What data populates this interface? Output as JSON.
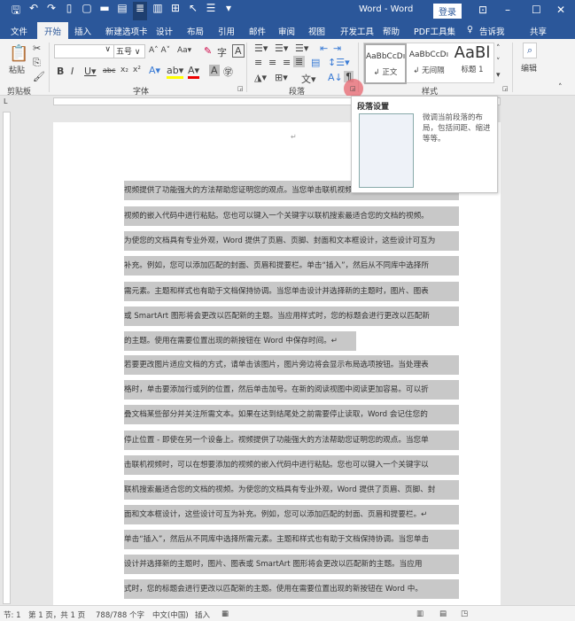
{
  "title": {
    "doc": "Word - Word",
    "login": "登录"
  },
  "tabs": [
    "文件",
    "开始",
    "插入",
    "新建选项卡",
    "设计",
    "布局",
    "引用",
    "邮件",
    "审阅",
    "视图",
    "开发工具",
    "帮助",
    "PDF工具集",
    "告诉我",
    "共享"
  ],
  "ribbon": {
    "paste": "粘贴",
    "clipboard": "剪贴板",
    "font": "字体",
    "font_size": "五号",
    "paragraph": "段落",
    "styles_group": "样式",
    "edit": "编辑",
    "styles": [
      {
        "preview": "AaBbCcDı",
        "name": "↲ 正文"
      },
      {
        "preview": "AaBbCcDı",
        "name": "↲ 无间隔"
      },
      {
        "preview": "AaBl",
        "name": "标题 1"
      }
    ]
  },
  "tooltip": {
    "title": "段落设置",
    "desc": "微调当前段落的布局，包括间距、缩进等等。"
  },
  "doc_lines": [
    "视频提供了功能强大的方法帮助您证明您的观点。当您单击联机视频时，可以在想要添加的",
    "视频的嵌入代码中进行粘贴。您也可以键入一个关键字以联机搜索最适合您的文档的视频。",
    "为使您的文档具有专业外观，Word 提供了页眉、页脚、封面和文本框设计，这些设计可互为",
    "补充。例如，您可以添加匹配的封面、页眉和提要栏。单击“插入”，然后从不同库中选择所",
    "需元素。主题和样式也有助于文档保持协调。当您单击设计并选择新的主题时，图片、图表",
    "或 SmartArt 图形将会更改以匹配新的主题。当应用样式时，您的标题会进行更改以匹配新",
    "的主题。使用在需要位置出现的新按钮在 Word 中保存时间。↵",
    "若要更改图片适应文档的方式，请单击该图片，图片旁边将会显示布局选项按钮。当处理表",
    "格时，单击要添加行或列的位置，然后单击加号。在新的阅读视图中阅读更加容易。可以折",
    "叠文档某些部分并关注所需文本。如果在达到结尾处之前需要停止读取，Word 会记住您的",
    "停止位置 - 即使在另一个设备上。视频提供了功能强大的方法帮助您证明您的观点。当您单",
    "击联机视频时，可以在想要添加的视频的嵌入代码中进行粘贴。您也可以键入一个关键字以",
    "联机搜索最适合您的文档的视频。为使您的文档具有专业外观，Word 提供了页眉、页脚、封",
    "面和文本框设计，这些设计可互为补充。例如，您可以添加匹配的封面、页眉和提要栏。↵",
    "单击“插入”，然后从不同库中选择所需元素。主题和样式也有助于文档保持协调。当您单击",
    "设计并选择新的主题时，图片、图表或 SmartArt 图形将会更改以匹配新的主题。当应用",
    "式时，您的标题会进行更改以匹配新的主题。使用在需要位置出现的新按钮在 Word 中。"
  ],
  "status": {
    "section": "节: 1",
    "page": "第 1 页，共 1 页",
    "words": "788/788 个字",
    "lang": "中文(中国)",
    "mode": "插入"
  }
}
